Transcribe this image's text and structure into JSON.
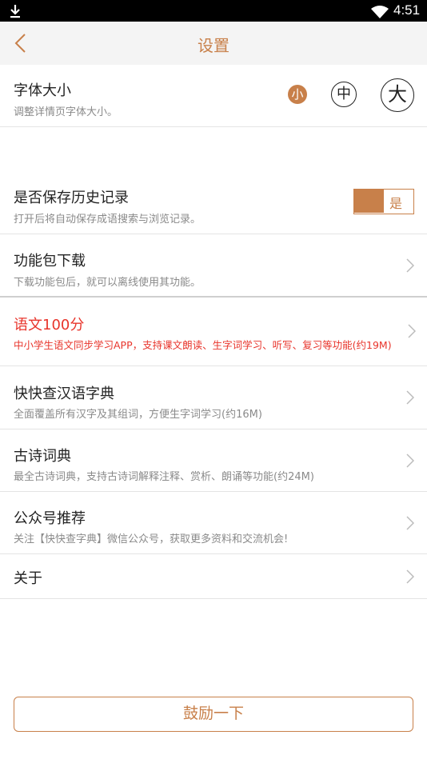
{
  "statusbar": {
    "time": "4:51"
  },
  "header": {
    "title": "设置"
  },
  "font_size": {
    "title": "字体大小",
    "desc": "调整详情页字体大小。",
    "options": [
      "小",
      "中",
      "大"
    ],
    "selected": "小"
  },
  "history": {
    "title": "是否保存历史记录",
    "desc": "打开后将自动保存成语搜索与浏览记录。",
    "toggle_label": "是"
  },
  "packages": {
    "title": "功能包下载",
    "desc": "下载功能包后，就可以离线使用其功能。"
  },
  "items": [
    {
      "title": "语文100分",
      "desc": "中小学生语文同步学习APP，支持课文朗读、生字词学习、听写、复习等功能(约19M)"
    },
    {
      "title": "快快查汉语字典",
      "desc": "全面覆盖所有汉字及其组词，方便生字词学习(约16M)"
    },
    {
      "title": "古诗词典",
      "desc": "最全古诗词典，支持古诗词解释注释、赏析、朗诵等功能(约24M)"
    },
    {
      "title": "公众号推荐",
      "desc": "关注【快快查字典】微信公众号，获取更多资料和交流机会!"
    }
  ],
  "about": {
    "title": "关于"
  },
  "cheer_button": "鼓励一下",
  "colors": {
    "accent": "#c8804a",
    "highlight": "#e8342b"
  }
}
